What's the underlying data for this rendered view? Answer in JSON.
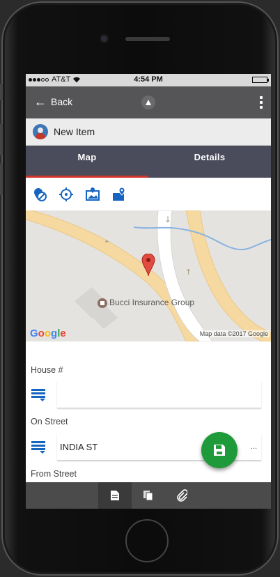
{
  "status_bar": {
    "carrier": "AT&T",
    "time": "4:54 PM"
  },
  "app_bar": {
    "back_label": "Back"
  },
  "item_header": {
    "title": "New Item"
  },
  "tabs": [
    {
      "label": "Map",
      "active": true
    },
    {
      "label": "Details",
      "active": false
    }
  ],
  "map_toolbar": {
    "icons": [
      "location-off-icon",
      "crosshair-icon",
      "map-photo-icon",
      "map-pins-icon"
    ]
  },
  "map": {
    "poi_label": "Bucci Insurance Group",
    "google_logo": "Google",
    "attribution": "Map data ©2017 Google"
  },
  "form": {
    "house_number": {
      "label": "House #",
      "value": ""
    },
    "on_street": {
      "label": "On Street",
      "value": "INDIA ST",
      "more": "..."
    },
    "from_street": {
      "label": "From Street"
    }
  },
  "bottom_nav": {
    "icons": [
      "document-icon",
      "copy-icon",
      "paperclip-icon"
    ],
    "active_index": 0
  },
  "colors": {
    "app_bar": "#555558",
    "tabs": "#4a4b5b",
    "tab_indicator": "#d0342c",
    "fab": "#1f9a3a",
    "accent_blue": "#1565c0"
  }
}
